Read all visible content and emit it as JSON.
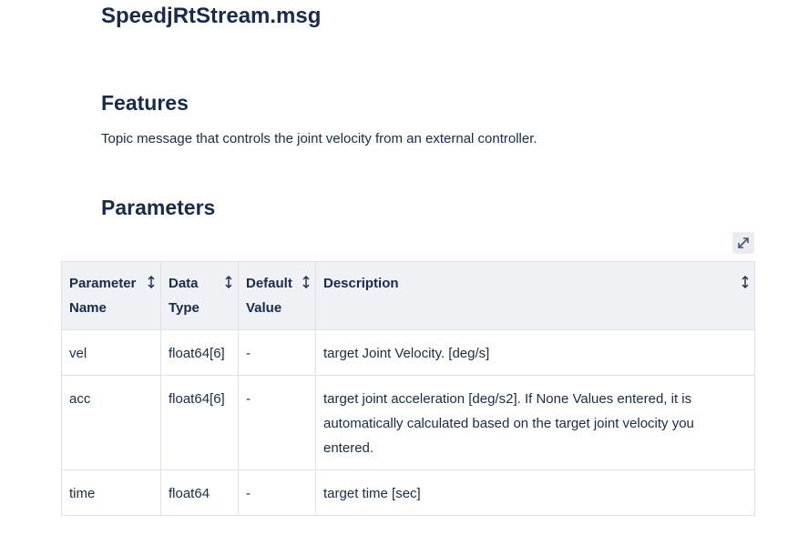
{
  "page": {
    "title": "SpeedjRtStream.msg"
  },
  "features": {
    "heading": "Features",
    "text": "Topic message that controls the joint velocity from an external controller."
  },
  "parameters": {
    "heading": "Parameters",
    "expand_icon": "expand-diagonal-icon",
    "table": {
      "headers": [
        "Parameter Name",
        "Data Type",
        "Default Value",
        "Description"
      ],
      "sort_icon": "sort-arrows-icon",
      "rows": [
        [
          "vel",
          "float64[6]",
          "-",
          "target Joint Velocity. [deg/s]"
        ],
        [
          "acc",
          "float64[6]",
          "-",
          "target joint acceleration [deg/s2]. If None Values entered, it is automatically calculated based on the target joint velocity you entered."
        ],
        [
          "time",
          "float64",
          "-",
          "target time [sec]"
        ]
      ]
    }
  },
  "colors": {
    "text": "#172b4d",
    "header_bg": "#f0f1f4",
    "border": "#dfe1e6",
    "button_bg": "#ebecf0"
  }
}
